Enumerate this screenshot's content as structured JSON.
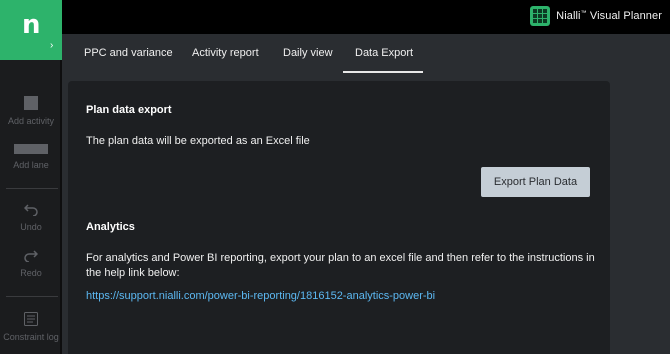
{
  "brand": {
    "name": "Nialli",
    "tm": "™",
    "product": "Visual Planner",
    "logo_letter": "n"
  },
  "tools": [
    {
      "label": "Add activity",
      "icon": "square-icon"
    },
    {
      "label": "Add lane",
      "icon": "lane-icon"
    },
    {
      "label": "Undo",
      "icon": "undo-icon"
    },
    {
      "label": "Redo",
      "icon": "redo-icon"
    },
    {
      "label": "Constraint log",
      "icon": "log-icon"
    }
  ],
  "tabs": [
    {
      "label": "PPC and variance"
    },
    {
      "label": "Activity report"
    },
    {
      "label": "Daily view"
    },
    {
      "label": "Data Export",
      "active": true
    }
  ],
  "export": {
    "heading": "Plan data export",
    "description": "The plan data will be exported as an Excel file",
    "button_label": "Export Plan Data"
  },
  "analytics": {
    "heading": "Analytics",
    "line1": "For analytics and Power BI reporting, export your plan to an excel file and then refer to the instructions in",
    "line2": "the help link below:",
    "link": "https://support.nialli.com/power-bi-reporting/1816152-analytics-power-bi"
  },
  "colors": {
    "accent": "#2db36b",
    "link": "#5cb8f2",
    "button_bg": "#c5ced6"
  }
}
